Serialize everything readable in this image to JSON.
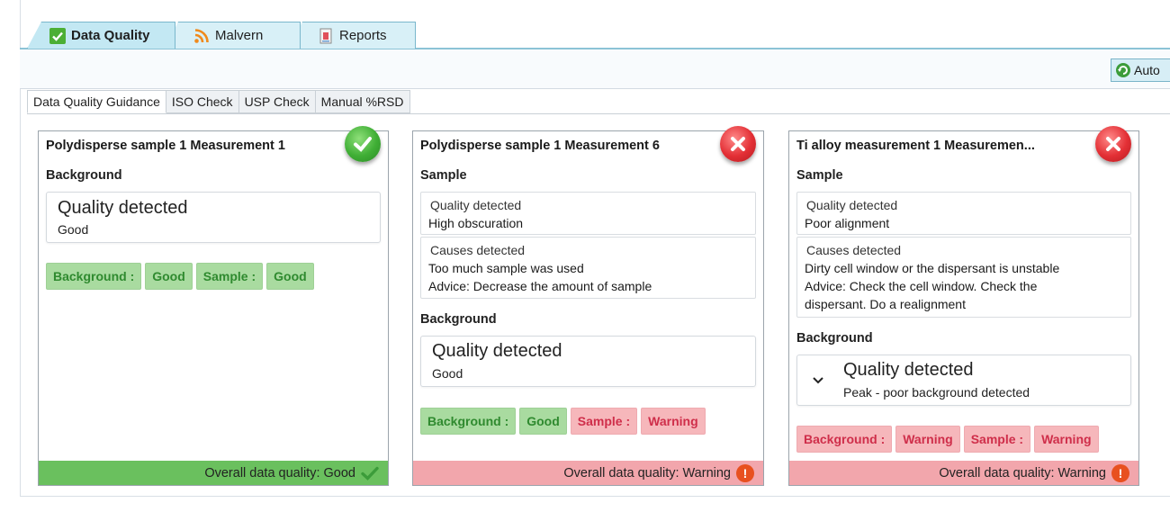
{
  "top_tabs": [
    {
      "label": "Data Quality",
      "icon": "check-icon",
      "active": true
    },
    {
      "label": "Malvern",
      "icon": "rss-icon",
      "active": false
    },
    {
      "label": "Reports",
      "icon": "report-icon",
      "active": false
    }
  ],
  "toolbar": {
    "auto_label": "Auto"
  },
  "sub_tabs": [
    "Data Quality Guidance",
    "ISO Check",
    "USP Check",
    "Manual %RSD"
  ],
  "colors": {
    "good": "#6ac05e",
    "warning": "#f2a6ac",
    "accent": "#7ab7cc"
  },
  "panels": [
    {
      "title": "Polydisperse sample 1  Measurement 1",
      "status": "good",
      "sections": {
        "background": {
          "heading": "Background",
          "quality_label": "Quality detected",
          "quality_value": "Good"
        }
      },
      "chips": [
        {
          "label": "Background :",
          "tone": "good"
        },
        {
          "label": "Good",
          "tone": "good"
        },
        {
          "label": "Sample :",
          "tone": "good"
        },
        {
          "label": "Good",
          "tone": "good"
        }
      ],
      "footer": "Overall data quality: Good"
    },
    {
      "title": "Polydisperse sample 1  Measurement 6",
      "status": "warning",
      "sections": {
        "sample": {
          "heading": "Sample",
          "quality_label": "Quality detected",
          "quality_value": "High obscuration",
          "causes_label": "Causes detected",
          "causes_value": "Too much sample was used",
          "advice": "Advice:  Decrease the amount of sample"
        },
        "background": {
          "heading": "Background",
          "quality_label": "Quality detected",
          "quality_value": "Good"
        }
      },
      "chips": [
        {
          "label": "Background :",
          "tone": "good"
        },
        {
          "label": "Good",
          "tone": "good"
        },
        {
          "label": "Sample :",
          "tone": "warning"
        },
        {
          "label": "Warning",
          "tone": "warning"
        }
      ],
      "footer": "Overall data quality: Warning"
    },
    {
      "title": "Ti alloy measurement 1  Measuremen...",
      "status": "warning",
      "sections": {
        "sample": {
          "heading": "Sample",
          "quality_label": "Quality detected",
          "quality_value": "Poor alignment",
          "causes_label": "Causes detected",
          "causes_value": "Dirty cell window or the dispersant is unstable",
          "advice_line1": "Advice:  Check the cell window. Check the",
          "advice_line2": "dispersant. Do a realignment"
        },
        "background": {
          "heading": "Background",
          "quality_label": "Quality detected",
          "quality_value": "Peak - poor background detected"
        }
      },
      "chips": [
        {
          "label": "Background :",
          "tone": "warning"
        },
        {
          "label": "Warning",
          "tone": "warning"
        },
        {
          "label": "Sample :",
          "tone": "warning"
        },
        {
          "label": "Warning",
          "tone": "warning"
        }
      ],
      "footer": "Overall data quality: Warning"
    }
  ]
}
